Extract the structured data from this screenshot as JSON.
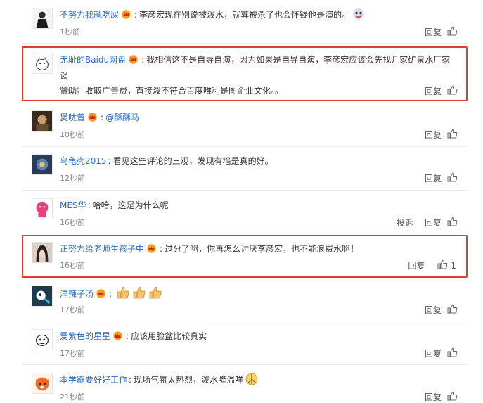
{
  "comments": [
    {
      "name": "不努力我就吃屎",
      "text": "李彦宏现在别说被泼水，就算被杀了也会怀疑他是演的。",
      "time": "1秒前",
      "reply": "回复"
    },
    {
      "name": "无耻的Baidu网盘",
      "text_line1": "我相信这不是自导自演，因为如果是自导自演，李彦宏应该会先找几家矿泉水厂家谈",
      "text_line2": "赞助，收取广告费，直接泼不符合百度唯利是图企业文化。。",
      "time": "7秒前",
      "reply": "回复"
    },
    {
      "name": "煲呔曾",
      "mention": "@酥酥马",
      "time": "10秒前",
      "reply": "回复"
    },
    {
      "name": "乌龟壳2015",
      "text": "看见这些评论的三观，发现有墙是真的好。",
      "time": "12秒前",
      "reply": "回复"
    },
    {
      "name": "MES华",
      "text": "哈哈，这是为什么呢",
      "time": "16秒前",
      "report": "投诉",
      "reply": "回复"
    },
    {
      "name": "正努力给老师生孩子中",
      "text": "过分了啊，你再怎么讨厌李彦宏，也不能浪费水啊！",
      "time": "16秒前",
      "reply": "回复",
      "likes": "1"
    },
    {
      "name": "洋辣子汤",
      "time": "17秒前",
      "reply": "回复"
    },
    {
      "name": "爱紫色的星星",
      "text": "应该用脸盆比较真实",
      "time": "17秒前",
      "reply": "回复"
    },
    {
      "name": "本学霸要好好工作",
      "text": "现场气氛太热烈，泼水降温咩",
      "time": "21秒前",
      "reply": "回复"
    }
  ],
  "colors": {
    "link": "#2a6ac2",
    "highlight": "#e03c31",
    "muted": "#8a8a8a",
    "vip_crown": "#f0a01e"
  },
  "icons": {
    "like": "thumbs-up-icon",
    "vip": "crown-icon",
    "thumbs_emoji": "thumbs-up-emoji"
  }
}
